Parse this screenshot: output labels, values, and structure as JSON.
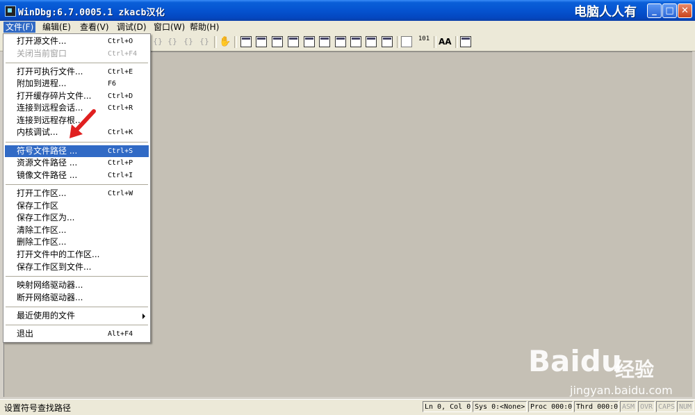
{
  "window": {
    "title": "WinDbg:6.7.0005.1 zkacb汉化",
    "brand": "电脑人人有",
    "icon": "windbg-app-icon",
    "controls": {
      "minimize": "_",
      "maximize": "□",
      "close": "✕"
    }
  },
  "menubar": [
    {
      "label": "文件(F)",
      "active": true
    },
    {
      "label": "编辑(E)"
    },
    {
      "label": "查看(V)"
    },
    {
      "label": "调试(D)"
    },
    {
      "label": "窗口(W)"
    },
    {
      "label": "帮助(H)"
    }
  ],
  "toolbar": {
    "step_icons": [
      "{}",
      "{}",
      "{}",
      "{}"
    ],
    "hand_icon": "✋",
    "value_icon": "101",
    "font_icon": "AA"
  },
  "file_menu": {
    "items": [
      {
        "label": "打开源文件...",
        "shortcut": "Ctrl+O"
      },
      {
        "label": "关闭当前窗口",
        "shortcut": "Ctrl+F4",
        "disabled": true
      },
      {
        "label": "打开可执行文件...",
        "shortcut": "Ctrl+E"
      },
      {
        "label": "附加到进程...",
        "shortcut": "F6"
      },
      {
        "label": "打开缓存碎片文件...",
        "shortcut": "Ctrl+D"
      },
      {
        "label": "连接到远程会话...",
        "shortcut": "Ctrl+R"
      },
      {
        "label": "连接到远程存根...",
        "shortcut": ""
      },
      {
        "label": "内核调试...",
        "shortcut": "Ctrl+K"
      },
      {
        "label": "符号文件路径 ...",
        "shortcut": "Ctrl+S",
        "highlighted": true
      },
      {
        "label": "资源文件路径 ...",
        "shortcut": "Ctrl+P"
      },
      {
        "label": "镜像文件路径 ...",
        "shortcut": "Ctrl+I"
      },
      {
        "label": "打开工作区...",
        "shortcut": "Ctrl+W"
      },
      {
        "label": "保存工作区",
        "shortcut": ""
      },
      {
        "label": "保存工作区为...",
        "shortcut": ""
      },
      {
        "label": "清除工作区...",
        "shortcut": ""
      },
      {
        "label": "删除工作区...",
        "shortcut": ""
      },
      {
        "label": "打开文件中的工作区...",
        "shortcut": ""
      },
      {
        "label": "保存工作区到文件...",
        "shortcut": ""
      },
      {
        "label": "映射网络驱动器...",
        "shortcut": ""
      },
      {
        "label": "断开网络驱动器...",
        "shortcut": ""
      },
      {
        "label": "最近使用的文件",
        "shortcut": "",
        "submenu": true
      },
      {
        "label": "退出",
        "shortcut": "Alt+F4"
      }
    ]
  },
  "watermark": {
    "logo": "Baidu",
    "cn": "经验",
    "url": "jingyan.baidu.com"
  },
  "statusbar": {
    "text": "设置符号查找路径",
    "panels": [
      "Ln 0, Col 0",
      "Sys 0:<None>",
      "Proc 000:0",
      "Thrd 000:0",
      "ASM",
      "OVR",
      "CAPS",
      "NUM"
    ]
  },
  "colors": {
    "titlebar": "#0553d0",
    "highlight": "#316ac5",
    "workspace": "#c5c0b5",
    "arrow": "#e02020"
  }
}
